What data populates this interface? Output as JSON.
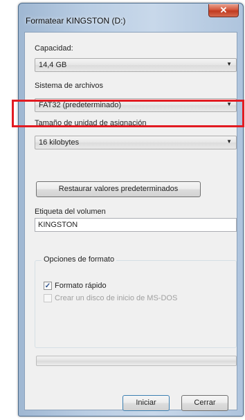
{
  "window": {
    "title": "Formatear KINGSTON (D:)",
    "close_glyph": "✕"
  },
  "capacity": {
    "label": "Capacidad:",
    "value": "14,4 GB"
  },
  "filesystem": {
    "label": "Sistema de archivos",
    "value": "FAT32 (predeterminado)"
  },
  "allocation": {
    "label": "Tamaño de unidad de asignación",
    "value": "16 kilobytes"
  },
  "restore_defaults_label": "Restaurar valores predeterminados",
  "volume": {
    "label": "Etiqueta del volumen",
    "value": "KINGSTON"
  },
  "format_options": {
    "title": "Opciones de formato",
    "quick_format": {
      "label": "Formato rápido",
      "checked": true
    },
    "msdos_disk": {
      "label": "Crear un disco de inicio de MS-DOS",
      "checked": false,
      "enabled": false
    }
  },
  "progress": {
    "fraction": 0
  },
  "buttons": {
    "start": "Iniciar",
    "close": "Cerrar"
  },
  "colors": {
    "highlight_border": "#e21b22",
    "close_button": "#c03a20"
  },
  "icons": {
    "dropdown": "chevron-down-icon",
    "checkmark": "checkmark-icon"
  }
}
